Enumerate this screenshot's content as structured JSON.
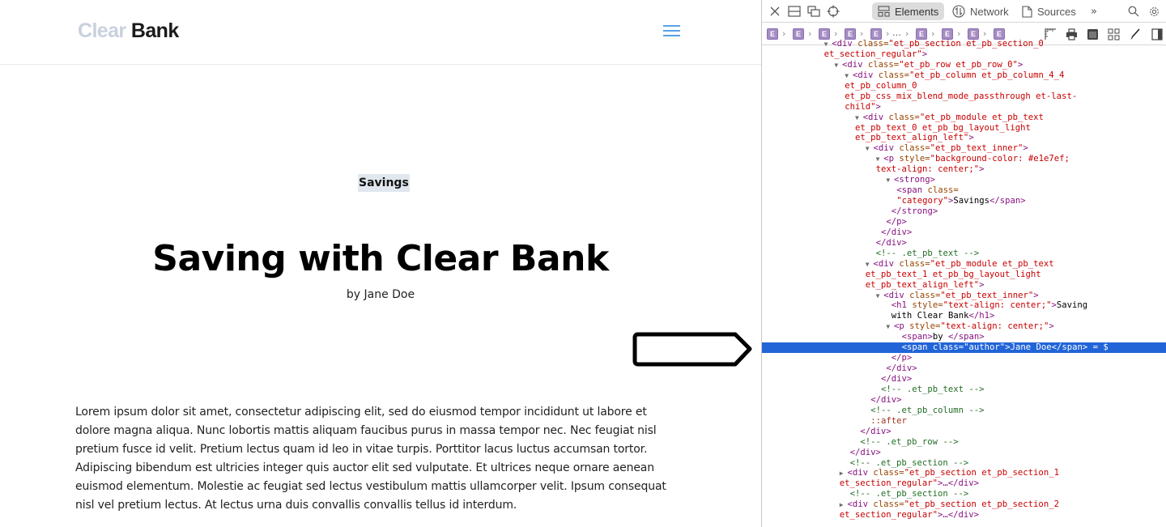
{
  "site": {
    "logo": {
      "part1": "Clear",
      "part2": "Bank"
    },
    "menu_icon": "hamburger-menu-icon",
    "category": "Savings",
    "title": "Saving with Clear Bank",
    "byline": "by Jane Doe",
    "body": "Lorem ipsum dolor sit amet, consectetur adipiscing elit, sed do eiusmod tempor incididunt ut labore et dolore magna aliqua. Nunc lobortis mattis aliquam faucibus purus in massa tempor nec. Nec feugiat nisl pretium fusce id velit. Pretium lectus quam id leo in vitae turpis. Porttitor lacus luctus accumsan tortor. Adipiscing bibendum est ultricies integer quis auctor elit sed vulputate. Et ultrices neque ornare aenean euismod elementum. Molestie ac feugiat sed lectus vestibulum mattis ullamcorper velit. Ipsum consequat nisl vel pretium lectus. At lectus urna duis convallis convallis tellus id interdum.",
    "colors": {
      "category_bg": "#e1e7ef",
      "logo_light": "#c9d1de",
      "menu": "#5aa2e6"
    }
  },
  "devtools": {
    "toolbar_icons": [
      "close-icon",
      "dock-bottom-icon",
      "undock-icon",
      "element-picker-icon"
    ],
    "tabs": [
      {
        "label": "Elements",
        "icon": "elements-icon",
        "active": true
      },
      {
        "label": "Network",
        "icon": "network-icon",
        "active": false
      },
      {
        "label": "Sources",
        "icon": "sources-icon",
        "active": false
      }
    ],
    "more_tabs": "»",
    "breadcrumb": {
      "crumb_label": "E",
      "ellipsis": "…"
    },
    "selection_color": "#2164d8",
    "dom_lines": [
      {
        "indent": 9,
        "parts": [
          [
            "tri",
            "▼ "
          ],
          [
            "tag",
            "<div "
          ],
          [
            "attr",
            "class="
          ],
          [
            "val",
            "\"et_pb_section et_pb_section_0"
          ]
        ]
      },
      {
        "indent": 9,
        "parts": [
          [
            "val",
            "et_section_regular\""
          ],
          [
            "tag",
            ">"
          ]
        ]
      },
      {
        "indent": 11,
        "parts": [
          [
            "tri",
            "▼ "
          ],
          [
            "tag",
            "<div "
          ],
          [
            "attr",
            "class="
          ],
          [
            "val",
            "\"et_pb_row et_pb_row_0\""
          ],
          [
            "tag",
            ">"
          ]
        ]
      },
      {
        "indent": 13,
        "parts": [
          [
            "tri",
            "▼ "
          ],
          [
            "tag",
            "<div "
          ],
          [
            "attr",
            "class="
          ],
          [
            "val",
            "\"et_pb_column et_pb_column_4_4"
          ]
        ]
      },
      {
        "indent": 13,
        "parts": [
          [
            "val",
            "et_pb_column_0"
          ]
        ]
      },
      {
        "indent": 13,
        "parts": [
          [
            "val",
            "et_pb_css_mix_blend_mode_passthrough et-last-"
          ]
        ]
      },
      {
        "indent": 13,
        "parts": [
          [
            "val",
            "child\""
          ],
          [
            "tag",
            ">"
          ]
        ]
      },
      {
        "indent": 15,
        "parts": [
          [
            "tri",
            "▼ "
          ],
          [
            "tag",
            "<div "
          ],
          [
            "attr",
            "class="
          ],
          [
            "val",
            "\"et_pb_module et_pb_text"
          ]
        ]
      },
      {
        "indent": 15,
        "parts": [
          [
            "val",
            "et_pb_text_0 et_pb_bg_layout_light"
          ]
        ]
      },
      {
        "indent": 15,
        "parts": [
          [
            "val",
            "et_pb_text_align_left\""
          ],
          [
            "tag",
            ">"
          ]
        ]
      },
      {
        "indent": 17,
        "parts": [
          [
            "tri",
            "▼ "
          ],
          [
            "tag",
            "<div "
          ],
          [
            "attr",
            "class="
          ],
          [
            "val",
            "\"et_pb_text_inner\""
          ],
          [
            "tag",
            ">"
          ]
        ]
      },
      {
        "indent": 19,
        "parts": [
          [
            "tri",
            "▼ "
          ],
          [
            "tag",
            "<p "
          ],
          [
            "attr",
            "style="
          ],
          [
            "val",
            "\"background-color: #e1e7ef;"
          ]
        ]
      },
      {
        "indent": 19,
        "parts": [
          [
            "val",
            "text-align: center;\""
          ],
          [
            "tag",
            ">"
          ]
        ]
      },
      {
        "indent": 21,
        "parts": [
          [
            "tri",
            "▼ "
          ],
          [
            "tag",
            "<strong>"
          ]
        ]
      },
      {
        "indent": 23,
        "parts": [
          [
            "tag",
            "<span "
          ],
          [
            "attr",
            "class="
          ]
        ]
      },
      {
        "indent": 23,
        "parts": [
          [
            "val",
            "\"category\""
          ],
          [
            "tag",
            ">"
          ],
          [
            "txt",
            "Savings"
          ],
          [
            "tag",
            "</span>"
          ]
        ]
      },
      {
        "indent": 22,
        "parts": [
          [
            "tag",
            "</strong>"
          ]
        ]
      },
      {
        "indent": 21,
        "parts": [
          [
            "tag",
            "</p>"
          ]
        ]
      },
      {
        "indent": 20,
        "parts": [
          [
            "tag",
            "</div>"
          ]
        ]
      },
      {
        "indent": 19,
        "parts": [
          [
            "tag",
            "</div>"
          ]
        ]
      },
      {
        "indent": 19,
        "parts": [
          [
            "cmt",
            "<!-- .et_pb_text -->"
          ]
        ]
      },
      {
        "indent": 17,
        "parts": [
          [
            "tri",
            "▼ "
          ],
          [
            "tag",
            "<div "
          ],
          [
            "attr",
            "class="
          ],
          [
            "val",
            "\"et_pb_module et_pb_text"
          ]
        ]
      },
      {
        "indent": 17,
        "parts": [
          [
            "val",
            "et_pb_text_1 et_pb_bg_layout_light"
          ]
        ]
      },
      {
        "indent": 17,
        "parts": [
          [
            "val",
            "et_pb_text_align_left\""
          ],
          [
            "tag",
            ">"
          ]
        ]
      },
      {
        "indent": 19,
        "parts": [
          [
            "tri",
            "▼ "
          ],
          [
            "tag",
            "<div "
          ],
          [
            "attr",
            "class="
          ],
          [
            "val",
            "\"et_pb_text_inner\""
          ],
          [
            "tag",
            ">"
          ]
        ]
      },
      {
        "indent": 22,
        "parts": [
          [
            "tag",
            "<h1 "
          ],
          [
            "attr",
            "style="
          ],
          [
            "val",
            "\"text-align: center;\""
          ],
          [
            "tag",
            ">"
          ],
          [
            "txt",
            "Saving"
          ]
        ]
      },
      {
        "indent": 22,
        "parts": [
          [
            "txt",
            "with Clear Bank"
          ],
          [
            "tag",
            "</h1>"
          ]
        ]
      },
      {
        "indent": 21,
        "parts": [
          [
            "tri",
            "▼ "
          ],
          [
            "tag",
            "<p "
          ],
          [
            "attr",
            "style="
          ],
          [
            "val",
            "\"text-align: center;\""
          ],
          [
            "tag",
            ">"
          ]
        ]
      },
      {
        "indent": 24,
        "parts": [
          [
            "tag",
            "<span>"
          ],
          [
            "txt",
            "by "
          ],
          [
            "tag",
            "</span>"
          ]
        ]
      },
      {
        "indent": 24,
        "selected": true,
        "parts": [
          [
            "tag",
            "<span "
          ],
          [
            "attr",
            "class="
          ],
          [
            "val",
            "\"author\""
          ],
          [
            "tag",
            ">"
          ],
          [
            "txt",
            "Jane Doe"
          ],
          [
            "tag",
            "</span>"
          ],
          [
            "txt",
            " = $"
          ]
        ]
      },
      {
        "indent": 22,
        "parts": [
          [
            "tag",
            "</p>"
          ]
        ]
      },
      {
        "indent": 21,
        "parts": [
          [
            "tag",
            "</div>"
          ]
        ]
      },
      {
        "indent": 20,
        "parts": [
          [
            "tag",
            "</div>"
          ]
        ]
      },
      {
        "indent": 20,
        "parts": [
          [
            "cmt",
            "<!-- .et_pb_text -->"
          ]
        ]
      },
      {
        "indent": 18,
        "parts": [
          [
            "tag",
            "</div>"
          ]
        ]
      },
      {
        "indent": 18,
        "parts": [
          [
            "cmt",
            "<!-- .et_pb_column -->"
          ]
        ]
      },
      {
        "indent": 18,
        "parts": [
          [
            "pseudo",
            "::after"
          ]
        ]
      },
      {
        "indent": 16,
        "parts": [
          [
            "tag",
            "</div>"
          ]
        ]
      },
      {
        "indent": 16,
        "parts": [
          [
            "cmt",
            "<!-- .et_pb_row -->"
          ]
        ]
      },
      {
        "indent": 14,
        "parts": [
          [
            "tag",
            "</div>"
          ]
        ]
      },
      {
        "indent": 14,
        "parts": [
          [
            "cmt",
            "<!-- .et_pb_section -->"
          ]
        ]
      },
      {
        "indent": 12,
        "parts": [
          [
            "tri",
            "▶ "
          ],
          [
            "tag",
            "<div "
          ],
          [
            "attr",
            "class="
          ],
          [
            "val",
            "\"et_pb_section et_pb_section_1"
          ]
        ]
      },
      {
        "indent": 12,
        "parts": [
          [
            "val",
            "et_section_regular\""
          ],
          [
            "tag",
            ">…</div>"
          ]
        ]
      },
      {
        "indent": 14,
        "parts": [
          [
            "cmt",
            "<!-- .et_pb_section -->"
          ]
        ]
      },
      {
        "indent": 12,
        "parts": [
          [
            "tri",
            "▶ "
          ],
          [
            "tag",
            "<div "
          ],
          [
            "attr",
            "class="
          ],
          [
            "val",
            "\"et_pb_section et_pb_section_2"
          ]
        ]
      },
      {
        "indent": 12,
        "parts": [
          [
            "val",
            "et_section_regular\""
          ],
          [
            "tag",
            ">…</div>"
          ]
        ]
      }
    ]
  }
}
